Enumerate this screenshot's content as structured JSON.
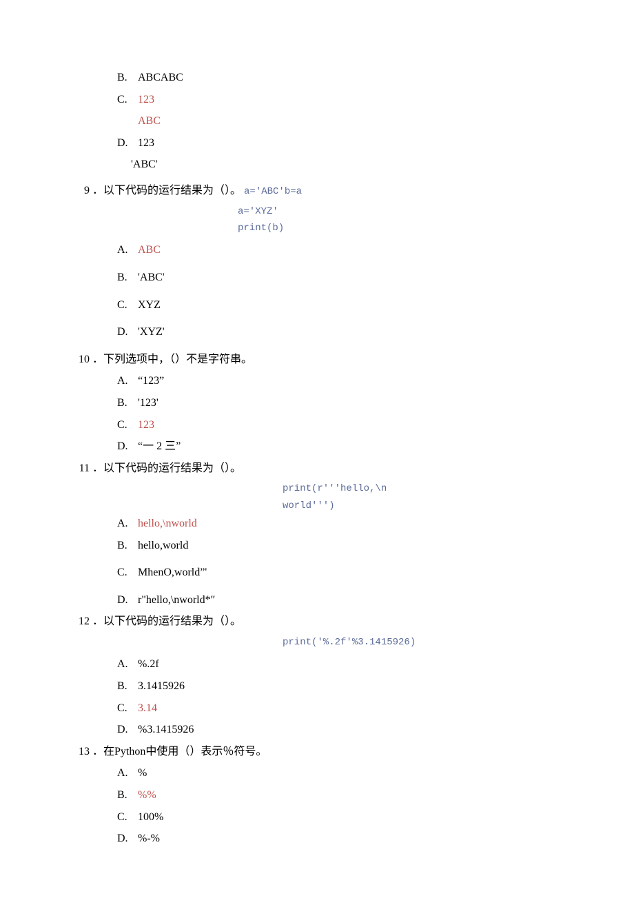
{
  "q8": {
    "optB": {
      "letter": "B.",
      "text": "ABCABC"
    },
    "optC": {
      "letter": "C.",
      "text1": "123",
      "text2": "ABC"
    },
    "optD": {
      "letter": "D.",
      "text1": "123",
      "text2": "'ABC'"
    }
  },
  "q9": {
    "num": "9",
    "stem": "．以下代码的运行结果为（）。",
    "code1": "a='ABC'b=a",
    "code2": "a='XYZ'",
    "code3": "print(b)",
    "A": {
      "letter": "A.",
      "text": "ABC"
    },
    "B": {
      "letter": "B.",
      "text": "'ABC'"
    },
    "C": {
      "letter": "C.",
      "text": "XYZ"
    },
    "D": {
      "letter": "D.",
      "text": "'XYZ'"
    }
  },
  "q10": {
    "num": "10",
    "stem": "．下列选项中，（）不是字符串。",
    "A": {
      "letter": "A.",
      "text": "“123”"
    },
    "B": {
      "letter": "B.",
      "text": "'123'"
    },
    "C": {
      "letter": "C.",
      "text": "123"
    },
    "D": {
      "letter": "D.",
      "text": "“一 2 三”"
    }
  },
  "q11": {
    "num": "11",
    "stem": "．以下代码的运行结果为（）。",
    "code1": "print(r'''hello,\\n",
    "code2": "world''')",
    "A": {
      "letter": "A.",
      "text": "hello,\\nworld"
    },
    "B": {
      "letter": "B.",
      "text": "hello,world"
    },
    "C": {
      "letter": "C.",
      "text": "MhenO,world”'"
    },
    "D": {
      "letter": "D.",
      "text": "r\"hello,\\nworld*″"
    }
  },
  "q12": {
    "num": "12",
    "stem": "．以下代码的运行结果为（）。",
    "code1": "print('%.2f'%3.1415926)",
    "A": {
      "letter": "A.",
      "text": "%.2f"
    },
    "B": {
      "letter": "B.",
      "text": "3.1415926"
    },
    "C": {
      "letter": "C.",
      "text": "3.14"
    },
    "D": {
      "letter": "D.",
      "text": "%3.1415926"
    }
  },
  "q13": {
    "num": "13",
    "stem": "．在Python中使用（）表示％符号。",
    "A": {
      "letter": "A.",
      "text": "%"
    },
    "B": {
      "letter": "B.",
      "text": "%%"
    },
    "C": {
      "letter": "C.",
      "text": "100%"
    },
    "D": {
      "letter": "D.",
      "text": "%-%"
    }
  }
}
